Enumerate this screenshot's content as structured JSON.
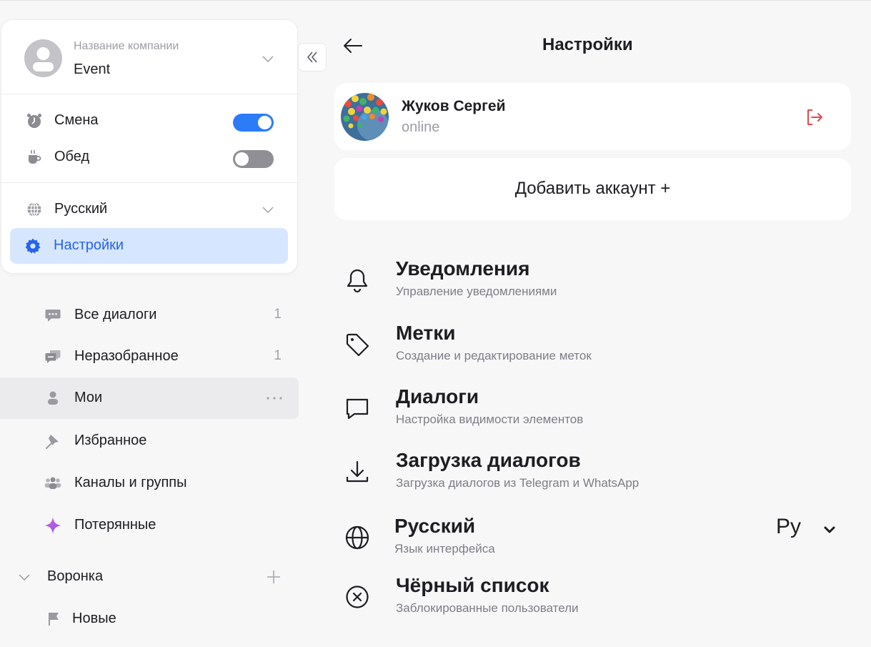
{
  "company": {
    "caption": "Название компании",
    "name": "Event"
  },
  "status": {
    "shift_label": "Смена",
    "shift_on": true,
    "lunch_label": "Обед",
    "lunch_on": false
  },
  "language_menu": {
    "label": "Русский"
  },
  "settings_menu": {
    "label": "Настройки"
  },
  "nav": {
    "items": [
      {
        "label": "Все диалоги",
        "count": "1"
      },
      {
        "label": "Неразобранное",
        "count": "1"
      },
      {
        "label": "Мои",
        "count": ""
      },
      {
        "label": "Избранное",
        "count": ""
      },
      {
        "label": "Каналы и группы",
        "count": ""
      },
      {
        "label": "Потерянные",
        "count": ""
      }
    ],
    "funnel": {
      "label": "Воронка",
      "child": "Новые"
    }
  },
  "header": {
    "title": "Настройки"
  },
  "profile": {
    "name": "Жуков Сергей",
    "status": "online"
  },
  "add_account": {
    "label": "Добавить аккаунт +"
  },
  "settings": [
    {
      "title": "Уведомления",
      "subtitle": "Управление уведомлениями"
    },
    {
      "title": "Метки",
      "subtitle": "Создание и редактирование меток"
    },
    {
      "title": "Диалоги",
      "subtitle": "Настройка видимости элементов"
    },
    {
      "title": "Загрузка диалогов",
      "subtitle": "Загрузка диалогов из Telegram и WhatsApp"
    },
    {
      "title": "Русский",
      "subtitle": "Язык интерфейса",
      "value": "Ру"
    },
    {
      "title": "Чёрный список",
      "subtitle": "Заблокированные пользователи"
    }
  ],
  "colors": {
    "accent": "#2b7cf6",
    "active_bg": "#d7e6ff",
    "logout": "#e5484d",
    "lost_gradient": [
      "#e35ad1",
      "#7c5cf5"
    ]
  }
}
